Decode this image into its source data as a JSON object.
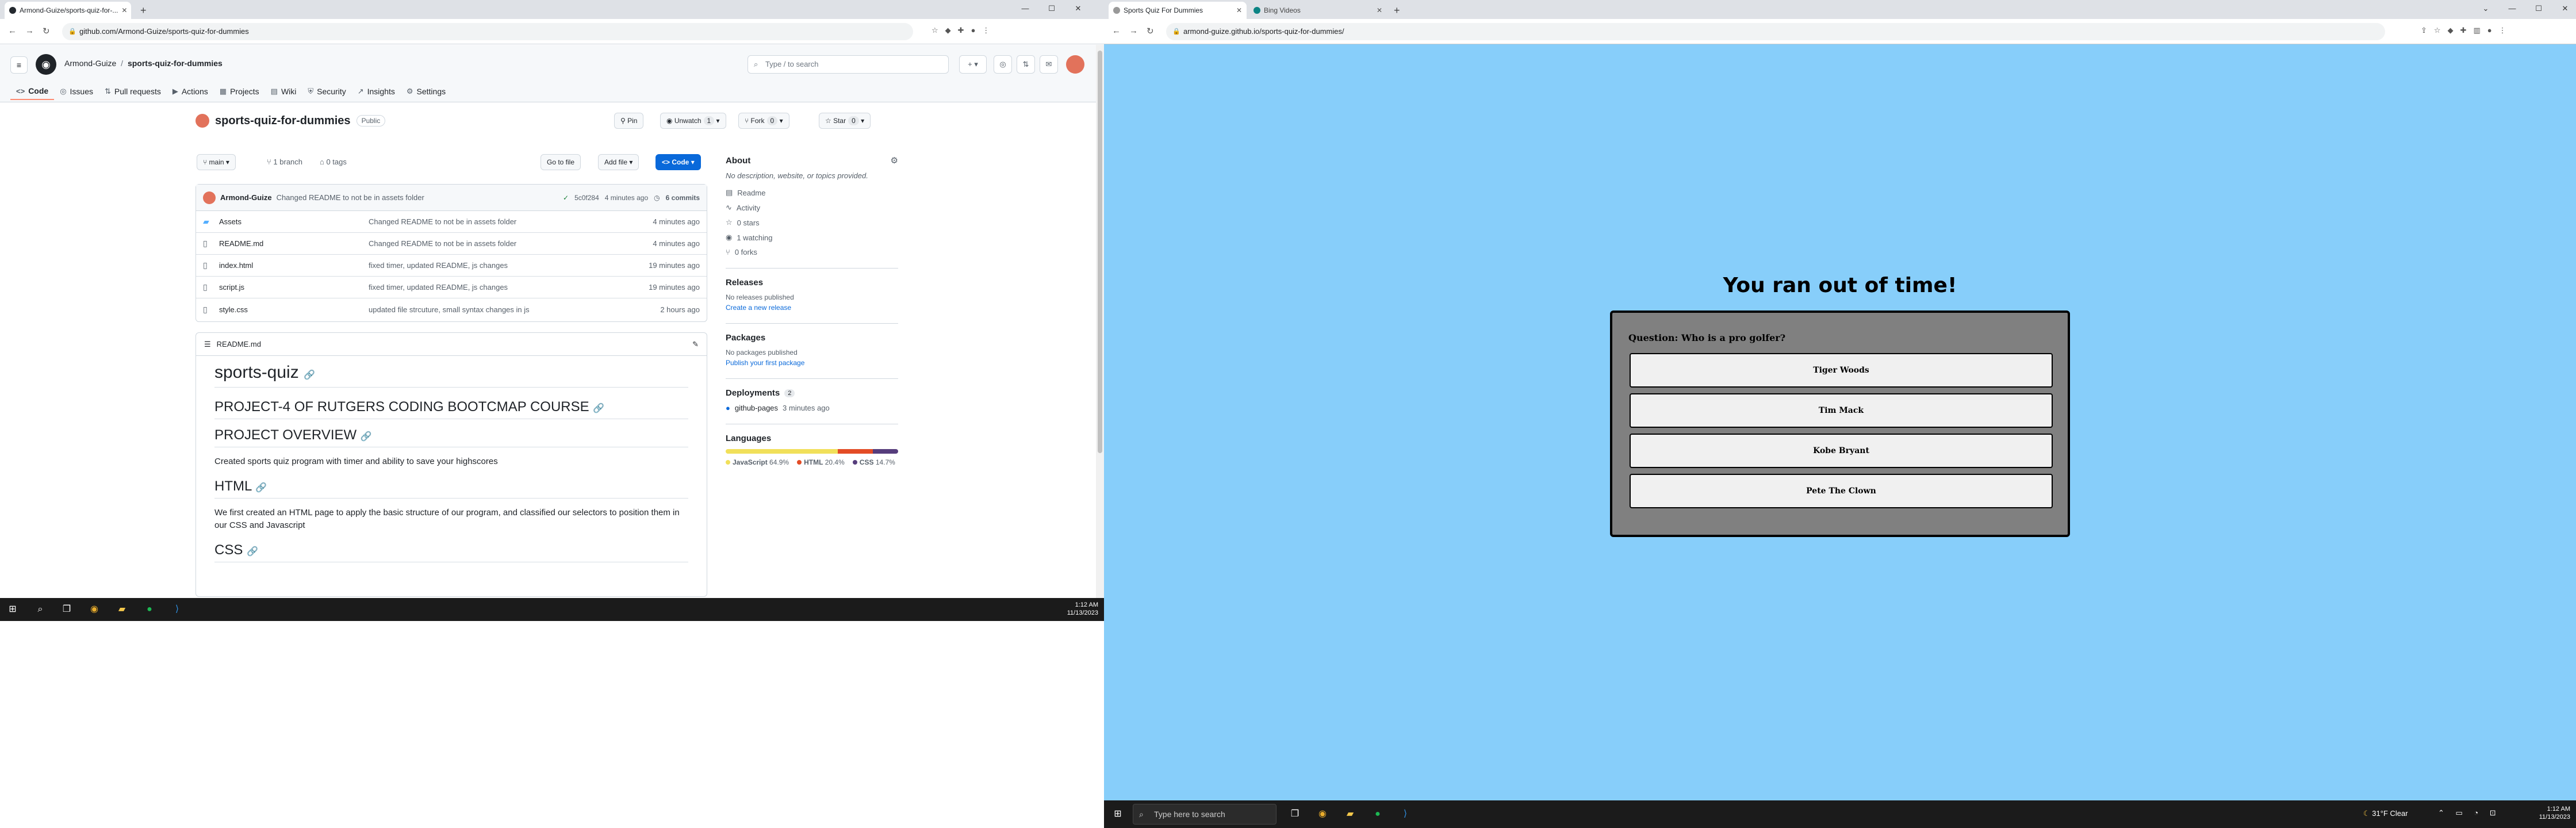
{
  "left": {
    "browser": {
      "tabs": [
        {
          "title": "Armond-Guize/sports-quiz-for-..."
        }
      ],
      "new_tab": "+",
      "url": "github.com/Armond-Guize/sports-quiz-for-dummies",
      "win": {
        "min": "—",
        "max": "☐",
        "close": "✕"
      }
    },
    "github": {
      "owner": "Armond-Guize",
      "sep": "/",
      "repo": "sports-quiz-for-dummies",
      "search_placeholder": "Type / to search",
      "tabs": [
        "Code",
        "Issues",
        "Pull requests",
        "Actions",
        "Projects",
        "Wiki",
        "Security",
        "Insights",
        "Settings"
      ],
      "repo_title": "sports-quiz-for-dummies",
      "visibility": "Public",
      "pin": "Pin",
      "unwatch": "Unwatch",
      "watch_count": "1",
      "fork": "Fork",
      "fork_count": "0",
      "star": "Star",
      "star_count": "0",
      "branch": "main",
      "branches": "1 branch",
      "tags": "0 tags",
      "go_to_file": "Go to file",
      "add_file": "Add file",
      "code_btn": "Code",
      "commit": {
        "author": "Armond-Guize",
        "message": "Changed README to not be in assets folder",
        "hash": "5c0f284",
        "time": "4 minutes ago",
        "count": "6 commits"
      },
      "files": [
        {
          "name": "Assets",
          "type": "folder",
          "msg": "Changed README to not be in assets folder",
          "date": "4 minutes ago"
        },
        {
          "name": "README.md",
          "type": "file",
          "msg": "Changed README to not be in assets folder",
          "date": "4 minutes ago"
        },
        {
          "name": "index.html",
          "type": "file",
          "msg": "fixed timer, updated README, js changes",
          "date": "19 minutes ago"
        },
        {
          "name": "script.js",
          "type": "file",
          "msg": "fixed timer, updated README, js changes",
          "date": "19 minutes ago"
        },
        {
          "name": "style.css",
          "type": "file",
          "msg": "updated file strcuture, small syntax changes in js",
          "date": "2 hours ago"
        }
      ],
      "readme": {
        "filename": "README.md",
        "h1": "sports-quiz",
        "h2a": "PROJECT-4 OF RUTGERS CODING BOOTCMAP COURSE",
        "h2b": "PROJECT OVERVIEW",
        "p1": "Created sports quiz program with timer and ability to save your highscores",
        "h2c": "HTML",
        "p2": "We first created an HTML page to apply the basic structure of our program, and classified our selectors to position them in our CSS and Javascript",
        "h2d": "CSS"
      },
      "about": {
        "title": "About",
        "desc": "No description, website, or topics provided.",
        "readme": "Readme",
        "activity": "Activity",
        "stars": "0 stars",
        "watching": "1 watching",
        "forks": "0 forks"
      },
      "releases": {
        "title": "Releases",
        "none": "No releases published",
        "link": "Create a new release"
      },
      "packages": {
        "title": "Packages",
        "none": "No packages published",
        "link": "Publish your first package"
      },
      "deployments": {
        "title": "Deployments",
        "count": "2",
        "item": "github-pages",
        "time": "3 minutes ago"
      },
      "languages": {
        "title": "Languages",
        "items": [
          {
            "name": "JavaScript",
            "pct": "64.9%",
            "value": 64.9,
            "color": "#f1e05a"
          },
          {
            "name": "HTML",
            "pct": "20.4%",
            "value": 20.4,
            "color": "#e34c26"
          },
          {
            "name": "CSS",
            "pct": "14.7%",
            "value": 14.7,
            "color": "#563d7c"
          }
        ]
      }
    },
    "taskbar": {
      "time": "1:12 AM",
      "date": "11/13/2023"
    }
  },
  "right": {
    "browser": {
      "tabs": [
        {
          "title": "Sports Quiz For Dummies"
        },
        {
          "title": "Bing Videos"
        }
      ],
      "url": "armond-guize.github.io/sports-quiz-for-dummies/"
    },
    "quiz": {
      "heading": "You ran out of time!",
      "question": "Question: Who is a pro golfer?",
      "answers": [
        "Tiger Woods",
        "Tim Mack",
        "Kobe Bryant",
        "Pete The Clown"
      ]
    },
    "taskbar": {
      "search": "Type here to search",
      "weather": "31°F  Clear",
      "time": "1:12 AM",
      "date": "11/13/2023"
    }
  }
}
